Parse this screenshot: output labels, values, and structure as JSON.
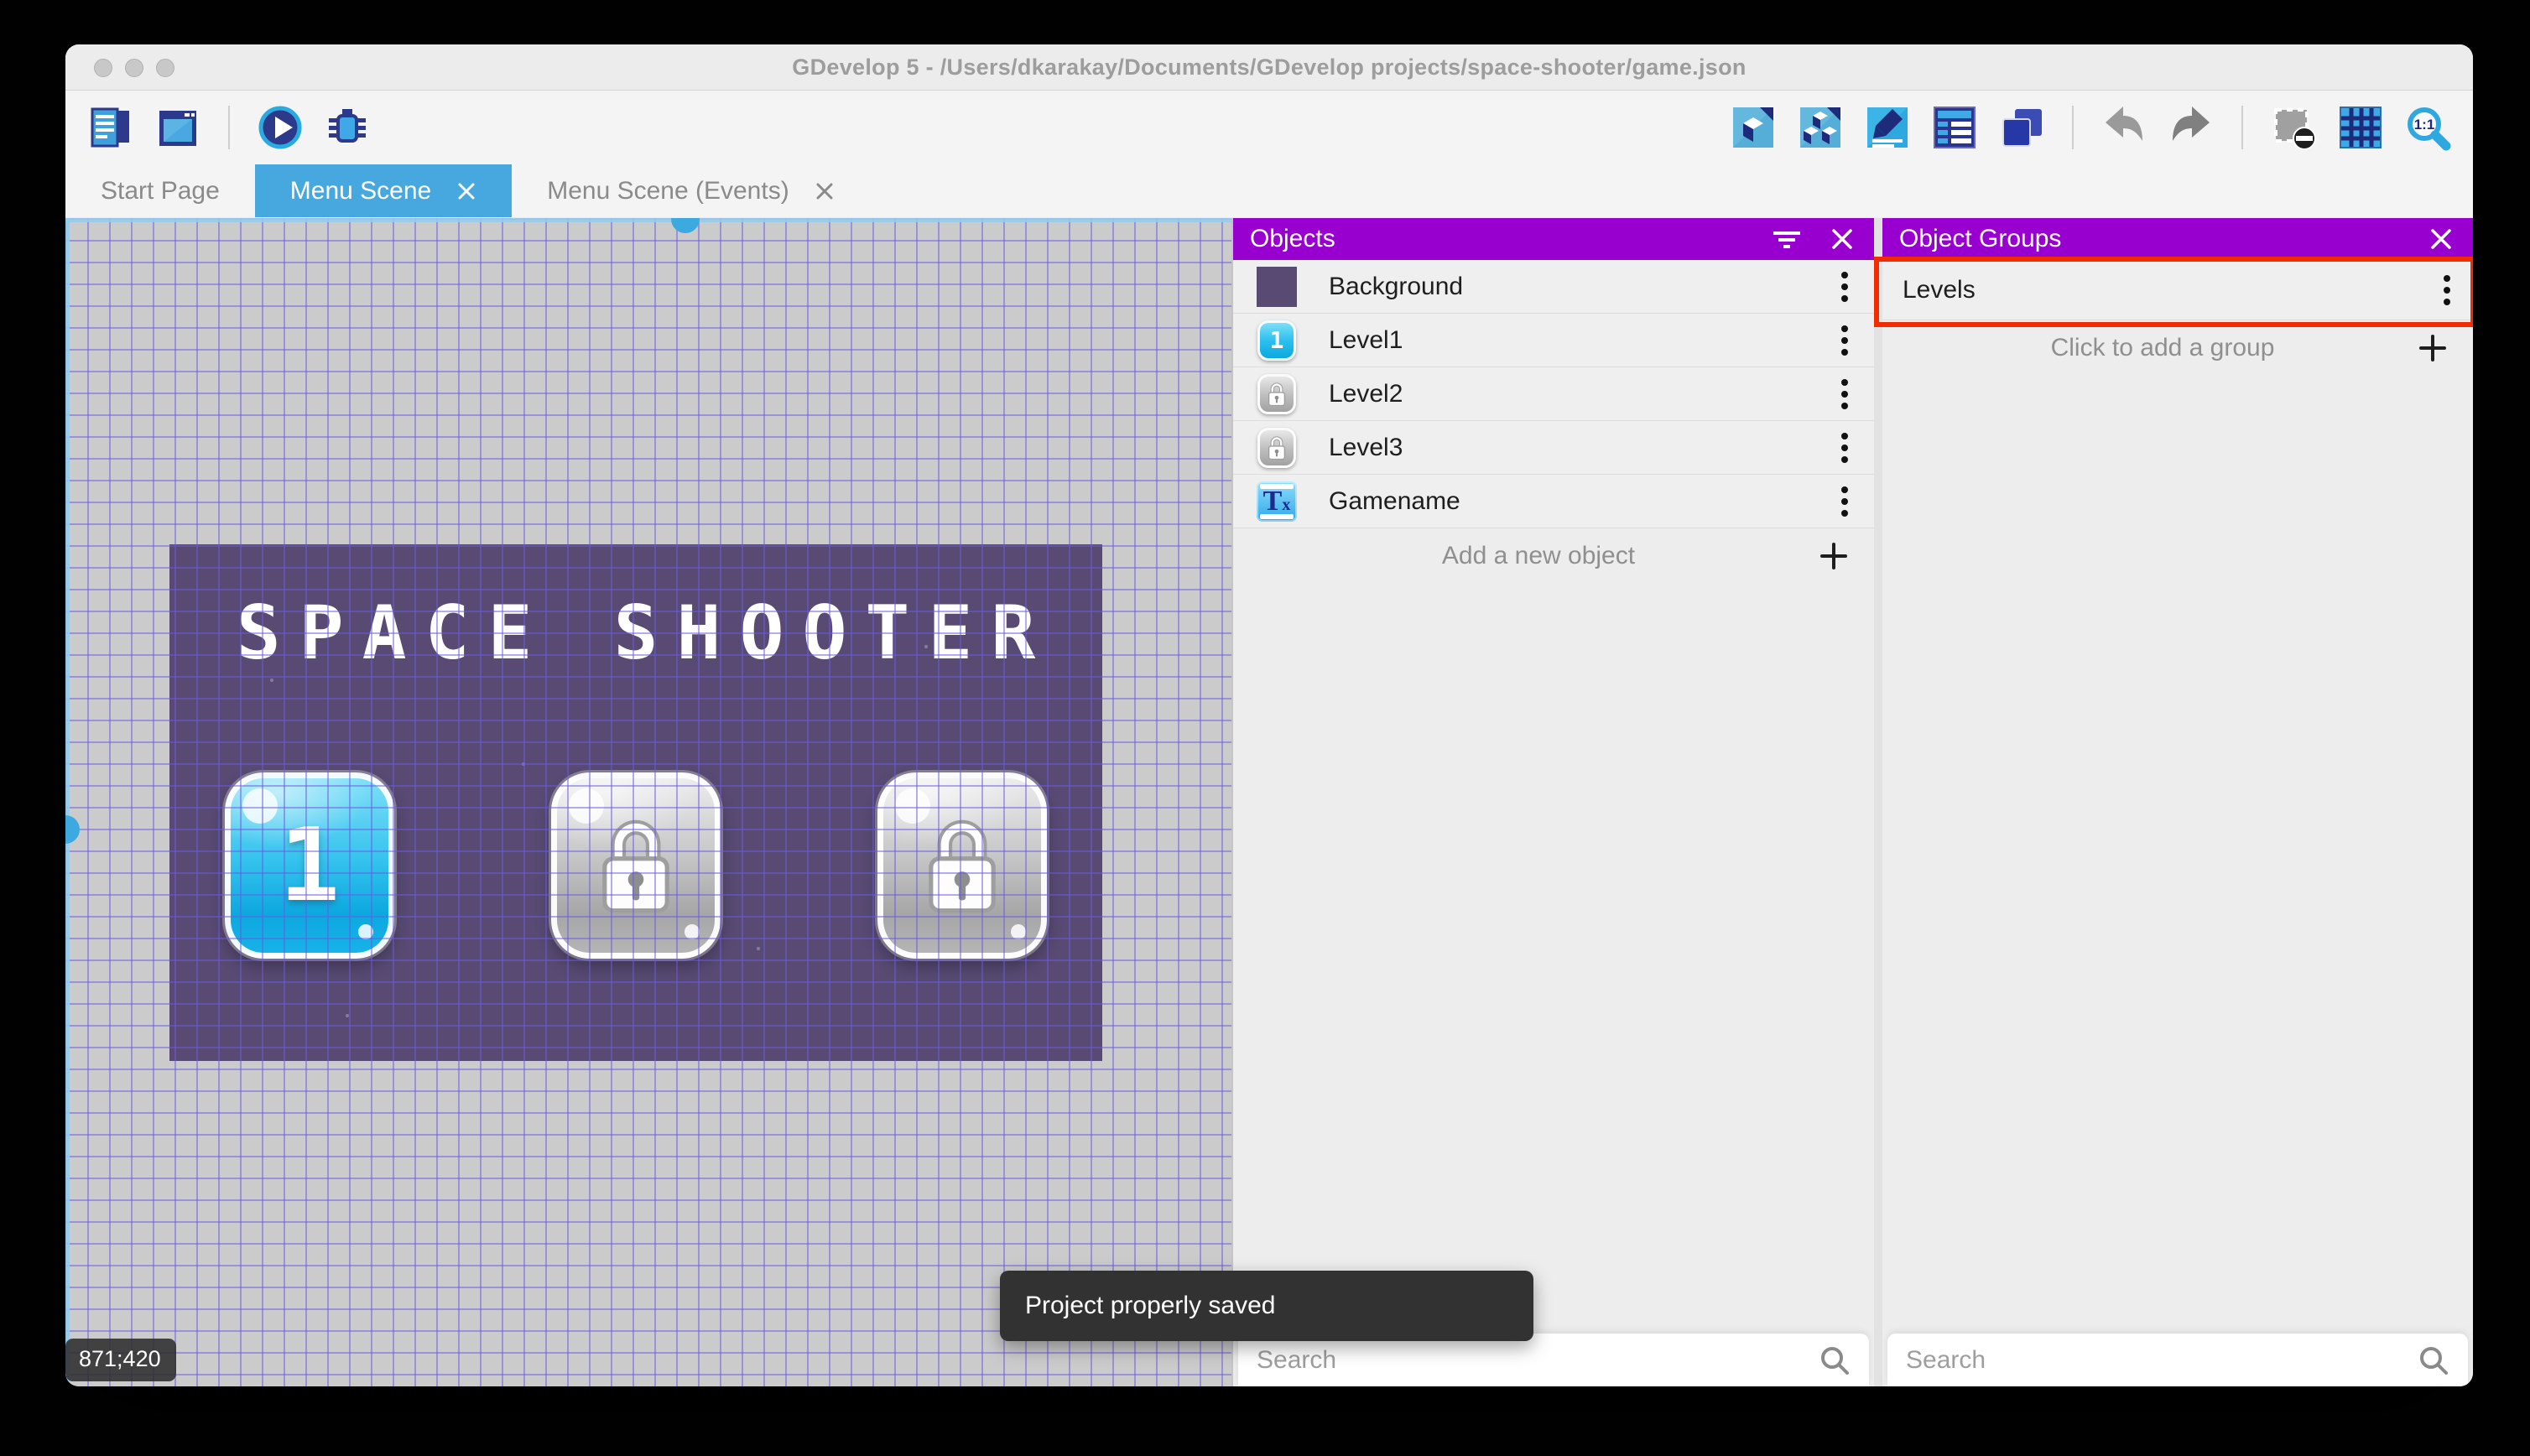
{
  "window_title": "GDevelop 5 - /Users/dkarakay/Documents/GDevelop projects/space-shooter/game.json",
  "tabs": [
    {
      "label": "Start Page",
      "active": false,
      "closable": false
    },
    {
      "label": "Menu Scene",
      "active": true,
      "closable": true
    },
    {
      "label": "Menu Scene (Events)",
      "active": false,
      "closable": true
    }
  ],
  "toolbar": {
    "left_icons": [
      "project-manager-icon",
      "open-scene-icon",
      "play-icon",
      "debug-icon"
    ],
    "right_icons": [
      "objects-editor-icon",
      "object-groups-editor-icon",
      "properties-icon",
      "instances-list-icon",
      "layers-icon",
      "undo-icon",
      "redo-icon",
      "mask-icon",
      "grid-icon",
      "zoom-icon"
    ],
    "zoom_label": "1:1"
  },
  "canvas": {
    "scene_title": "SPACE SHOOTER",
    "level_buttons": [
      {
        "label": "1",
        "state": "unlocked"
      },
      {
        "label": "",
        "state": "locked"
      },
      {
        "label": "",
        "state": "locked"
      }
    ],
    "coordinates": "871;420"
  },
  "objects_panel": {
    "title": "Objects",
    "items": [
      {
        "name": "Background",
        "icon": "background-swatch"
      },
      {
        "name": "Level1",
        "icon": "level-button-unlocked",
        "icon_text": "1"
      },
      {
        "name": "Level2",
        "icon": "level-button-locked"
      },
      {
        "name": "Level3",
        "icon": "level-button-locked"
      },
      {
        "name": "Gamename",
        "icon": "text-object",
        "icon_text": "Tx"
      }
    ],
    "add_label": "Add a new object",
    "search_placeholder": "Search"
  },
  "groups_panel": {
    "title": "Object Groups",
    "groups": [
      {
        "name": "Levels",
        "highlighted": true
      }
    ],
    "add_label": "Click to add a group",
    "search_placeholder": "Search"
  },
  "toast": {
    "message": "Project properly saved"
  },
  "colors": {
    "accent_purple": "#9800cf",
    "accent_blue": "#47a8e0",
    "annotation_red": "#f32b00",
    "scene_background": "#584a73"
  }
}
